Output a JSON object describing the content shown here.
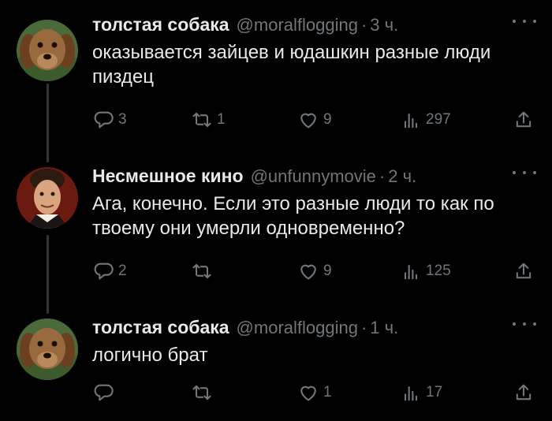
{
  "tweets": [
    {
      "name": "толстая собака",
      "handle": "@moralflogging",
      "sep": "·",
      "time": "3 ч.",
      "text": "оказывается зайцев и юдашкин разные люди пиздец",
      "replies": "3",
      "retweets": "1",
      "likes": "9",
      "views": "297"
    },
    {
      "name": "Несмешное кино",
      "handle": "@unfunnymovie",
      "sep": "·",
      "time": "2 ч.",
      "text": "Ага, конечно. Если это разные люди то как по твоему они умерли одновременно?",
      "replies": "2",
      "retweets": "",
      "likes": "9",
      "views": "125"
    },
    {
      "name": "толстая собака",
      "handle": "@moralflogging",
      "sep": "·",
      "time": "1 ч.",
      "text": "логично брат",
      "replies": "",
      "retweets": "",
      "likes": "1",
      "views": "17"
    }
  ],
  "icons": {
    "reply": "reply-icon",
    "retweet": "retweet-icon",
    "like": "like-icon",
    "views": "views-icon",
    "share": "share-icon",
    "more": "more-icon"
  },
  "colors": {
    "background": "#000000",
    "text": "#e7e9ea",
    "secondary": "#71767b",
    "thread_line": "#333639"
  }
}
